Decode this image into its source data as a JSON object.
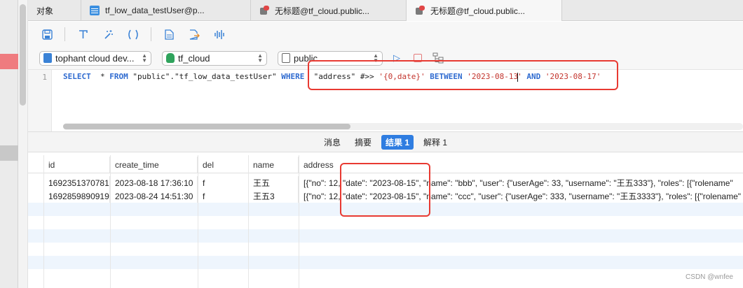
{
  "tabs": [
    {
      "label": "对象",
      "icon": "none",
      "active": false
    },
    {
      "label": "tf_low_data_testUser@p...",
      "icon": "table-icon",
      "active": false
    },
    {
      "label": "无标题@tf_cloud.public...",
      "icon": "query-icon",
      "active": false
    },
    {
      "label": "无标题@tf_cloud.public...",
      "icon": "query-icon",
      "active": true
    }
  ],
  "toolbar": {
    "icons": [
      "save-icon",
      "format-icon",
      "magic-wand-icon",
      "parentheses-icon",
      "document-icon",
      "export-icon",
      "waveform-icon"
    ]
  },
  "selectors": {
    "connection": "tophant cloud dev...",
    "database": "tf_cloud",
    "schema": "public"
  },
  "editor": {
    "line_number": "1",
    "sql": {
      "select": "SELECT",
      "star": "  * ",
      "from": "FROM",
      "table": " \"public\".\"tf_low_data_testUser\" ",
      "where": "WHERE",
      "column": "  \"address\" #>> ",
      "path": "'{0,date}'",
      "between": "BETWEEN",
      "d1a": "'2023-08-13",
      "d1b": "'",
      "and": "AND",
      "d2": "'2023-08-17'"
    }
  },
  "result_tabs": [
    "消息",
    "摘要",
    "结果 1",
    "解释 1"
  ],
  "active_result_tab": "结果 1",
  "grid": {
    "columns": [
      "id",
      "create_time",
      "del",
      "name",
      "address"
    ],
    "rows": [
      [
        "1692351370781",
        "2023-08-18 17:36:10",
        "f",
        "王五",
        "[{\"no\": 12, \"date\": \"2023-08-15\", \"name\": \"bbb\", \"user\": {\"userAge\": 33, \"username\": \"王五333\"}, \"roles\": [{\"rolename\""
      ],
      [
        "1692859890919",
        "2023-08-24 14:51:30",
        "f",
        "王五3",
        "[{\"no\": 12, \"date\": \"2023-08-15\", \"name\": \"ccc\", \"user\": {\"userAge\": 333, \"username\": \"王五3333\"}, \"roles\": [{\"rolename\""
      ]
    ]
  },
  "watermark": "CSDN @wnfee",
  "colors": {
    "accent": "#2f7de1",
    "annotation": "#e83a32",
    "keyword": "#2f6bd0",
    "string": "#c3342d"
  }
}
